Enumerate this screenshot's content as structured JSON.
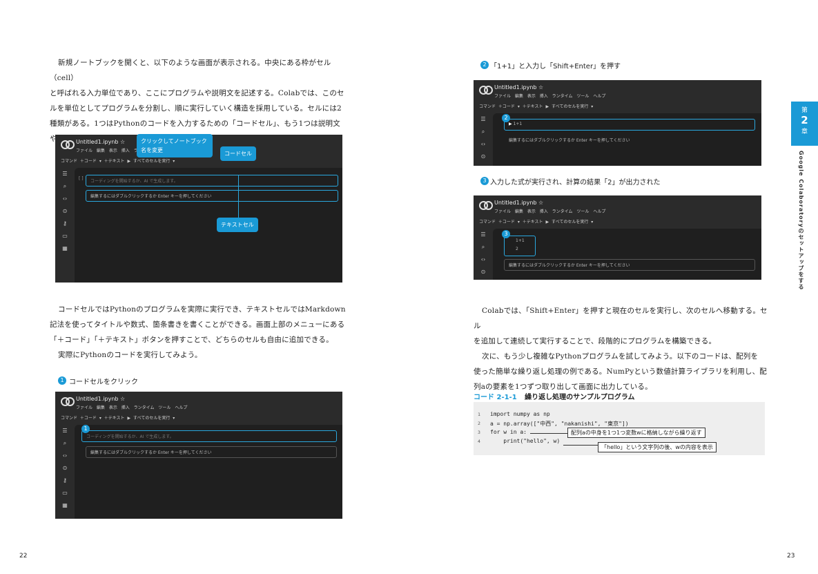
{
  "left_page": {
    "intro_lines": [
      "新規ノートブックを開くと、以下のような画面が表示される。中央にある枠がセル（cell）",
      "と呼ばれる入力単位であり、ここにプログラムや説明文を記述する。Colabでは、このセ",
      "ルを単位としてプログラムを分割し、順に実行していく構造を採用している。セルには2",
      "種類がある。1つはPythonのコードを入力するための「コードセル」、もう1つは説明文",
      "や見出しを記述するための「テキストセル」である。"
    ],
    "body_lines": [
      "コードセルではPythonのプログラムを実際に実行でき、テキストセルではMarkdown",
      "記法を使ってタイトルや数式、箇条書きを書くことができる。画面上部のメニューにある",
      "「＋コード」「＋テキスト」ボタンを押すことで、どちらのセルも自由に追加できる。",
      "実際にPythonのコードを実行してみよう。"
    ],
    "step1_num": "1",
    "step1_label": "コードセルをクリック",
    "page_number": "22"
  },
  "callouts": {
    "rename": [
      "クリックしてノートブック",
      "名を変更"
    ],
    "code_cell": "コードセル",
    "text_cell": "テキストセル"
  },
  "colab": {
    "filename": "Untitled1.ipynb",
    "star": "☆",
    "menu": "ファイル 編集 表示 挿入 ランタイム ツール ヘルプ",
    "toolbar": "コマンド ＋コード ▾ ＋テキスト ▶ すべてのセルを実行 ▾",
    "code_placeholder": "コーディングを開始するか、AI で生成します。",
    "text_placeholder": "編集するにはダブルクリックするか Enter キーを押してください",
    "code_input": "1+1",
    "output": "2",
    "cell_bracket": "[ ]",
    "run_bracket": "[1]"
  },
  "right_page": {
    "step2_num": "2",
    "step2_label": "「1+1」と入力し「Shift+Enter」を押す",
    "step3_num": "3",
    "step3_label": "入力した式が実行され、計算の結果「2」が出力された",
    "body_lines": [
      "Colabでは、「Shift+Enter」を押すと現在のセルを実行し、次のセルへ移動する。セル",
      "を追加して連続して実行することで、段階的にプログラムを構築できる。",
      "次に、もう少し複雑なPythonプログラムを試してみよう。以下のコードは、配列を",
      "使った簡単な繰り返し処理の例である。NumPyという数値計算ライブラリを利用し、配",
      "列aの要素を1つずつ取り出して画面に出力している。"
    ],
    "code_caption_num": "コード 2-1-1",
    "code_caption_title": "繰り返し処理のサンプルプログラム",
    "code_lines": [
      {
        "n": "1",
        "t": "import numpy as np"
      },
      {
        "n": "2",
        "t": "a = np.array([\"中西\", \"nakanishi\", \"東京\"])"
      },
      {
        "n": "3",
        "t": "for w in a:"
      },
      {
        "n": "4",
        "t": "    print(\"hello\", w)"
      }
    ],
    "anno1": "配列aの中身を1つ1つ変数wに格納しながら繰り返す",
    "anno2": "「hello」という文字列の後、wの内容を表示",
    "page_number": "23"
  },
  "chapter_tab": {
    "label_top": "第",
    "number": "2",
    "label_bottom": "章",
    "side_title": "Google Colaboratoryのセットアップをする"
  }
}
